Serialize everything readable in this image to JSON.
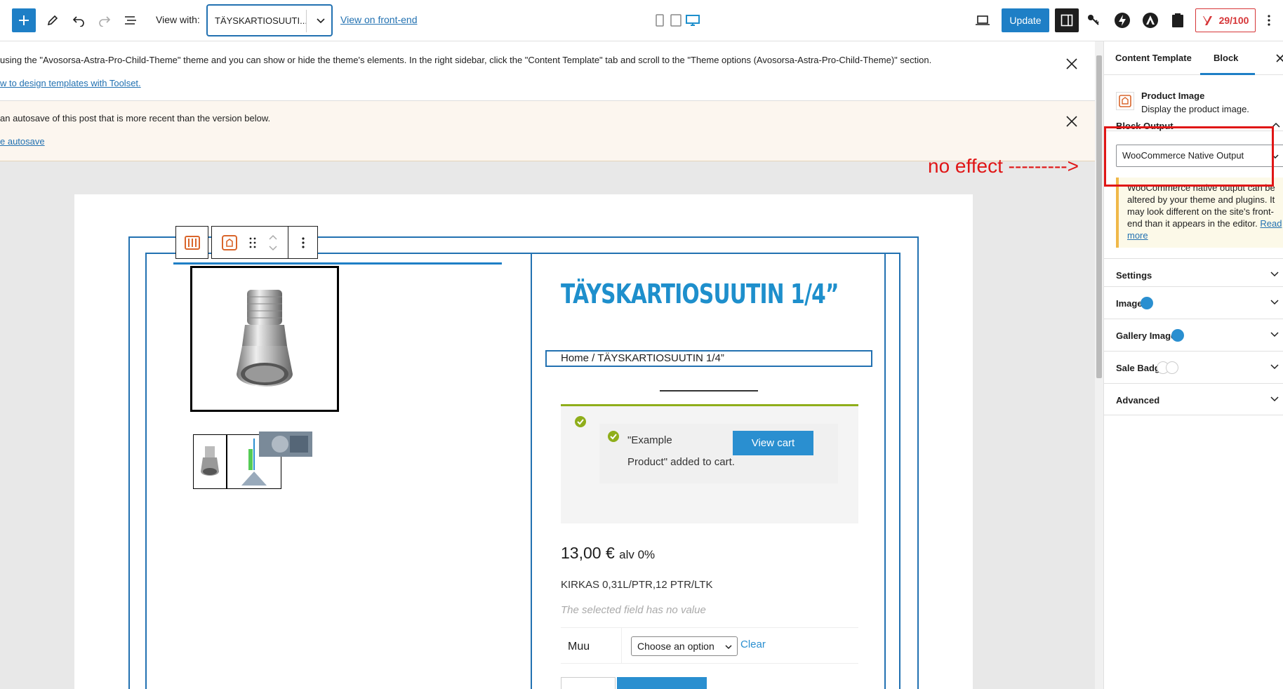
{
  "toolbar": {
    "view_with_label": "View with:",
    "template_select_value": "TÄYSKARTIOSUUTI...",
    "view_frontend_link": "View on front-end",
    "update_label": "Update",
    "seo_score": "29/100",
    "accent": "#1e7fc6",
    "score_color": "#d63638"
  },
  "notices": {
    "theme_text": "using the \"Avosorsa-Astra-Pro-Child-Theme\" theme and you can show or hide the theme's elements. In the right sidebar, click the \"Content Template\" tab and scroll to the \"Theme options (Avosorsa-Astra-Pro-Child-Theme)\" section.",
    "theme_link": "w to design templates with Toolset.",
    "autosave_text": "an autosave of this post that is more recent than the version below.",
    "autosave_link": "e autosave"
  },
  "annotation": "no effect --------->",
  "product": {
    "title": "TÄYSKARTIOSUUTIN 1/4”",
    "breadcrumb": "Home / TÄYSKARTIOSUUTIN 1/4”",
    "cart_message_line1": "\"Example",
    "cart_message_line2": "Product\" added to cart.",
    "view_cart": "View cart",
    "price": "13,00 €",
    "price_suffix": "alv 0%",
    "description": "KIRKAS 0,31L/PTR,12 PTR/LTK",
    "no_value_text": "The selected field has no value",
    "variation_label": "Muu",
    "variation_select": "Choose an option",
    "variation_clear": "Clear"
  },
  "sidebar": {
    "tabs": [
      "Content Template",
      "Block"
    ],
    "block_name": "Product Image",
    "block_desc": "Display the product image.",
    "block_output_label": "Block Output",
    "block_output_value": "WooCommerce Native Output",
    "warning_text": "WooCommerce native output can be altered by your theme and plugins. It may look different on the site's front-end than it appears in the editor.",
    "warning_link": "Read more",
    "panels": [
      "Settings",
      "Image",
      "Gallery Images",
      "Sale Badge",
      "Advanced"
    ]
  }
}
